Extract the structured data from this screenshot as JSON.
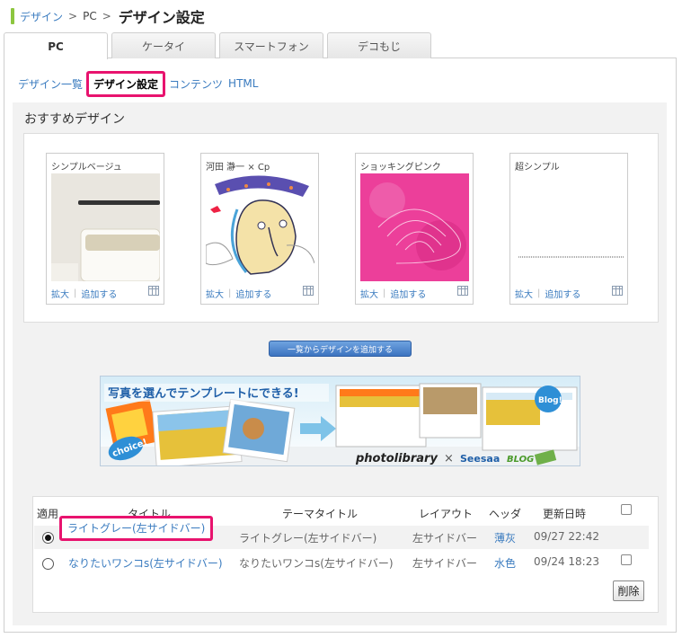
{
  "breadcrumb": {
    "root": "デザイン",
    "sep": ">",
    "pc": "PC",
    "current": "デザイン設定"
  },
  "tabs": [
    "PC",
    "ケータイ",
    "スマートフォン",
    "デコもじ"
  ],
  "subnav": [
    "デザイン一覧",
    "デザイン設定",
    "コンテンツ",
    "HTML"
  ],
  "section_title": "おすすめデザイン",
  "cards": [
    {
      "title": "シンプルベージュ",
      "zoom": "拡大",
      "add": "追加する"
    },
    {
      "title": "河田 瀞一 × Cp",
      "zoom": "拡大",
      "add": "追加する"
    },
    {
      "title": "ショッキングピンク",
      "zoom": "拡大",
      "add": "追加する"
    },
    {
      "title": "超シンプル",
      "zoom": "拡大",
      "add": "追加する"
    }
  ],
  "add_from_list_button": "一覧からデザインを追加する",
  "banner": {
    "headline": "写真を選んでテンプレートにできる!",
    "choice": "choice!",
    "blog": "Blog!",
    "brand1": "photolibrary",
    "times": "×",
    "brand2": "Seesaa",
    "brand3": "BLOG"
  },
  "table": {
    "headers": [
      "適用",
      "タイトル",
      "テーマタイトル",
      "レイアウト",
      "ヘッダ",
      "更新日時"
    ],
    "rows": [
      {
        "selected": true,
        "title": "ライトグレー(左サイドバー)",
        "theme": "ライトグレー(左サイドバー)",
        "layout": "左サイドバー",
        "header": "薄灰",
        "updated": "09/27 22:42"
      },
      {
        "selected": false,
        "title": "なりたいワンコs(左サイドバー)",
        "theme": "なりたいワンコs(左サイドバー)",
        "layout": "左サイドバー",
        "header": "水色",
        "updated": "09/24 18:23"
      }
    ],
    "delete_button": "削除"
  },
  "colors": {
    "accent": "#e8136e",
    "link": "#3a7bbf",
    "green": "#8dc63f"
  }
}
